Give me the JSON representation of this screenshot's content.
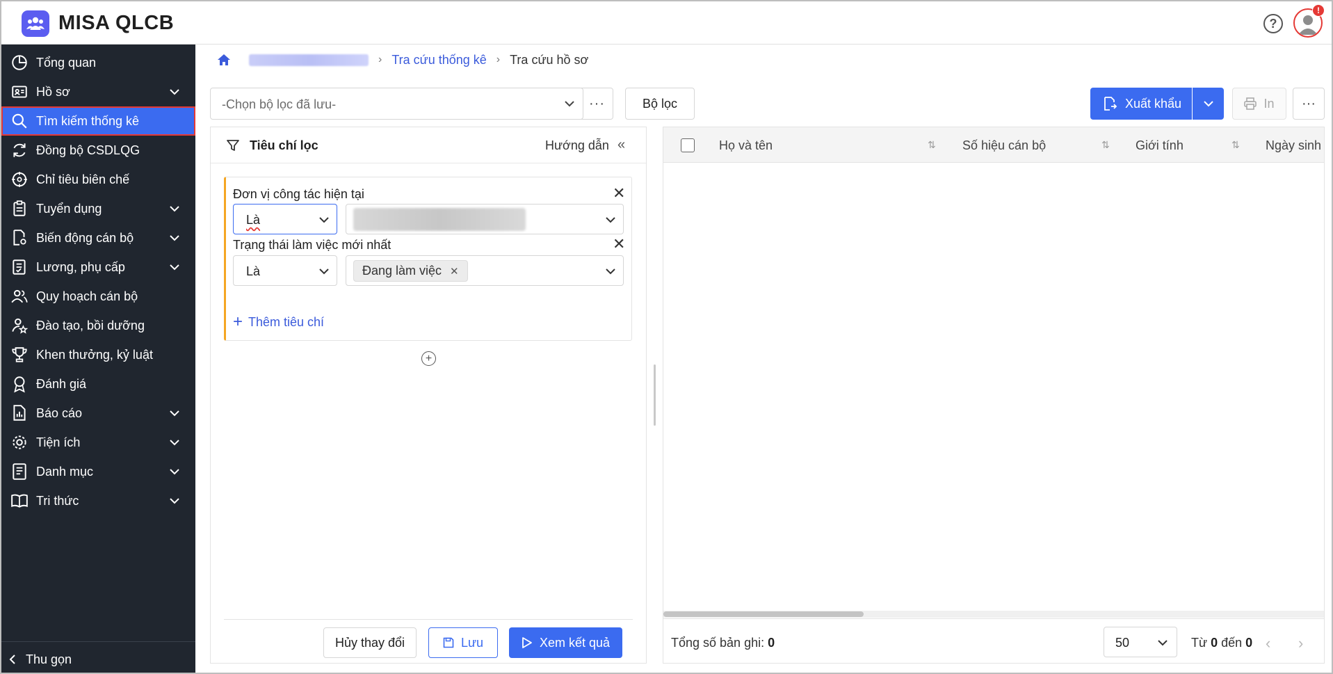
{
  "app": {
    "name": "MISA QLCB"
  },
  "header": {
    "help_icon": "?",
    "notification_count": "!"
  },
  "sidebar": {
    "items": [
      {
        "label": "Tổng quan",
        "icon": "pie-chart-icon",
        "expandable": false
      },
      {
        "label": "Hồ sơ",
        "icon": "id-card-icon",
        "expandable": true
      },
      {
        "label": "Tìm kiếm thống kê",
        "icon": "search-icon",
        "expandable": false,
        "active": true
      },
      {
        "label": "Đồng bộ CSDLQG",
        "icon": "sync-icon",
        "expandable": false
      },
      {
        "label": "Chỉ tiêu biên chế",
        "icon": "target-icon",
        "expandable": false
      },
      {
        "label": "Tuyển dụng",
        "icon": "clipboard-icon",
        "expandable": true
      },
      {
        "label": "Biến động cán bộ",
        "icon": "document-settings-icon",
        "expandable": true
      },
      {
        "label": "Lương, phụ cấp",
        "icon": "checklist-icon",
        "expandable": true
      },
      {
        "label": "Quy hoạch cán bộ",
        "icon": "users-icon",
        "expandable": false
      },
      {
        "label": "Đào tạo, bồi dưỡng",
        "icon": "user-star-icon",
        "expandable": false
      },
      {
        "label": "Khen thưởng, kỷ luật",
        "icon": "trophy-icon",
        "expandable": false
      },
      {
        "label": "Đánh giá",
        "icon": "award-icon",
        "expandable": false
      },
      {
        "label": "Báo cáo",
        "icon": "report-icon",
        "expandable": true
      },
      {
        "label": "Tiện ích",
        "icon": "gear-icon",
        "expandable": true
      },
      {
        "label": "Danh mục",
        "icon": "list-document-icon",
        "expandable": true
      },
      {
        "label": "Tri thức",
        "icon": "book-icon",
        "expandable": true
      }
    ],
    "collapse_label": "Thu gọn"
  },
  "breadcrumb": {
    "items": [
      "Tra cứu thống kê",
      "Tra cứu hồ sơ"
    ]
  },
  "toolbar": {
    "saved_filter_placeholder": "-Chọn bộ lọc đã lưu-",
    "more_label": "···",
    "filter_button": "Bộ lọc",
    "export_button": "Xuất khẩu",
    "print_button": "In",
    "more_right_label": "···"
  },
  "filter_panel": {
    "title": "Tiêu chí lọc",
    "guide": "Hướng dẫn",
    "collapse": "«",
    "criteria": [
      {
        "label": "Đơn vị công tác hiện tại",
        "operator": "Là",
        "value": "",
        "value_blurred": true
      },
      {
        "label": "Trạng thái làm việc mới nhất",
        "operator": "Là",
        "tags": [
          "Đang làm việc"
        ]
      }
    ],
    "add_criteria": "Thêm tiêu chí",
    "add_group": "+",
    "buttons": {
      "cancel": "Hủy thay đổi",
      "save": "Lưu",
      "view": "Xem kết quả"
    }
  },
  "grid": {
    "columns": [
      "Họ và tên",
      "Số hiệu cán bộ",
      "Giới tính",
      "Ngày sinh"
    ],
    "total_label": "Tổng số bản ghi:",
    "total_value": "0",
    "page_size": "50",
    "range_from_label": "Từ",
    "range_from": "0",
    "range_to_label": "đến",
    "range_to": "0"
  },
  "colors": {
    "accent": "#3b6bf0",
    "sidebar_bg": "#20262f",
    "active_outline": "#e53935",
    "criteria_border": "#f5a623"
  }
}
